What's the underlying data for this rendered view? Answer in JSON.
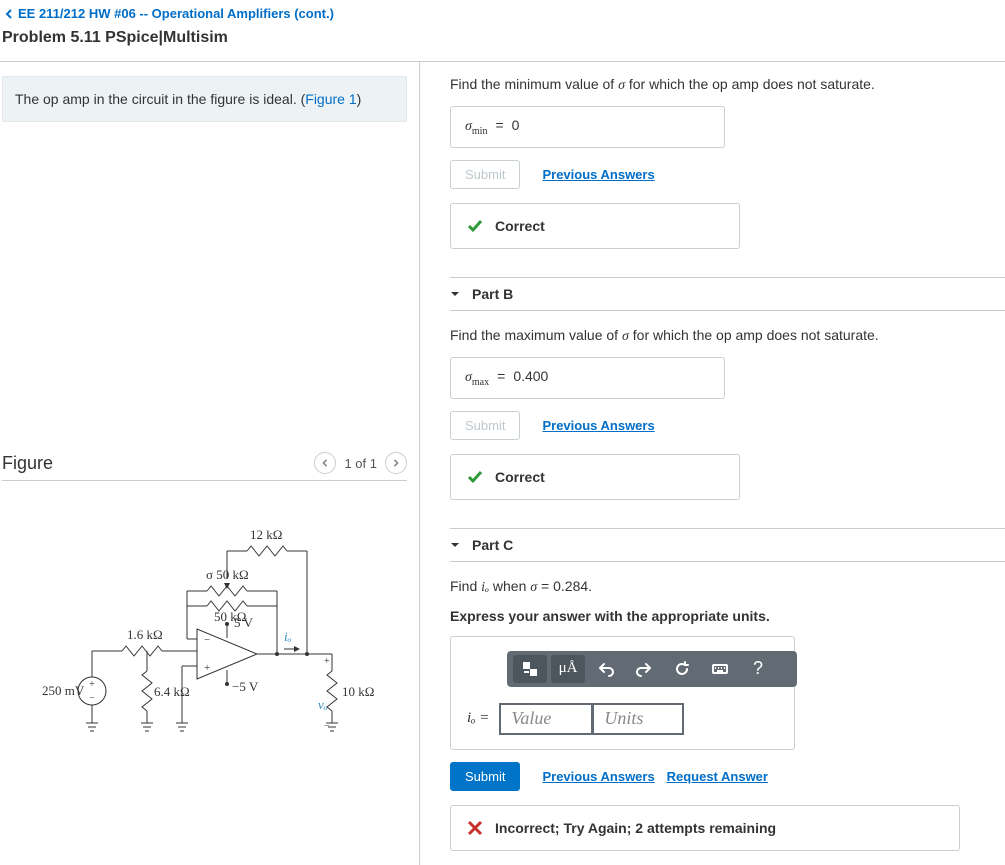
{
  "nav": {
    "back_label": "EE 211/212 HW #06 -- Operational Amplifiers (cont.)"
  },
  "problem": {
    "title": "Problem 5.11 PSpice|Multisim"
  },
  "intro": {
    "text_before": "The op amp in the circuit in the figure is ideal. (",
    "figure_link": "Figure 1",
    "text_after": ")"
  },
  "figure": {
    "label": "Figure",
    "pager": "1 of 1"
  },
  "circuit": {
    "r_top": "12 kΩ",
    "r_sigma": "σ 50 kΩ",
    "r_mid": "50 kΩ",
    "r_in": "1.6 kΩ",
    "r_gnd": "6.4 kΩ",
    "r_out": "10 kΩ",
    "v_src": "250 mV",
    "v_plus": "5 V",
    "v_minus": "−5 V",
    "i_label": "iₒ",
    "v_label": "vₒ"
  },
  "partA": {
    "question_pre": "Find the minimum value of ",
    "question_var": "σ",
    "question_post": " for which the op amp does not saturate.",
    "var_label": "σ",
    "sub": "min",
    "eq": "=",
    "value": "0",
    "submit": "Submit",
    "prev": "Previous Answers",
    "status": "Correct"
  },
  "partB": {
    "header": "Part B",
    "question_pre": "Find the maximum value of ",
    "question_var": "σ",
    "question_post": " for which the op amp does not saturate.",
    "var_label": "σ",
    "sub": "max",
    "eq": "=",
    "value": "0.400",
    "submit": "Submit",
    "prev": "Previous Answers",
    "status": "Correct"
  },
  "partC": {
    "header": "Part C",
    "q1_pre": "Find ",
    "q1_var": "iₒ",
    "q1_mid": " when ",
    "q1_var2": "σ",
    "q1_eq": " = 0.284.",
    "instr": "Express your answer with the appropriate units.",
    "unit_hint": "μÅ",
    "lhs": "iₒ =",
    "value_ph": "Value",
    "units_ph": "Units",
    "submit": "Submit",
    "prev": "Previous Answers",
    "req": "Request Answer",
    "err": "Incorrect; Try Again; 2 attempts remaining"
  }
}
